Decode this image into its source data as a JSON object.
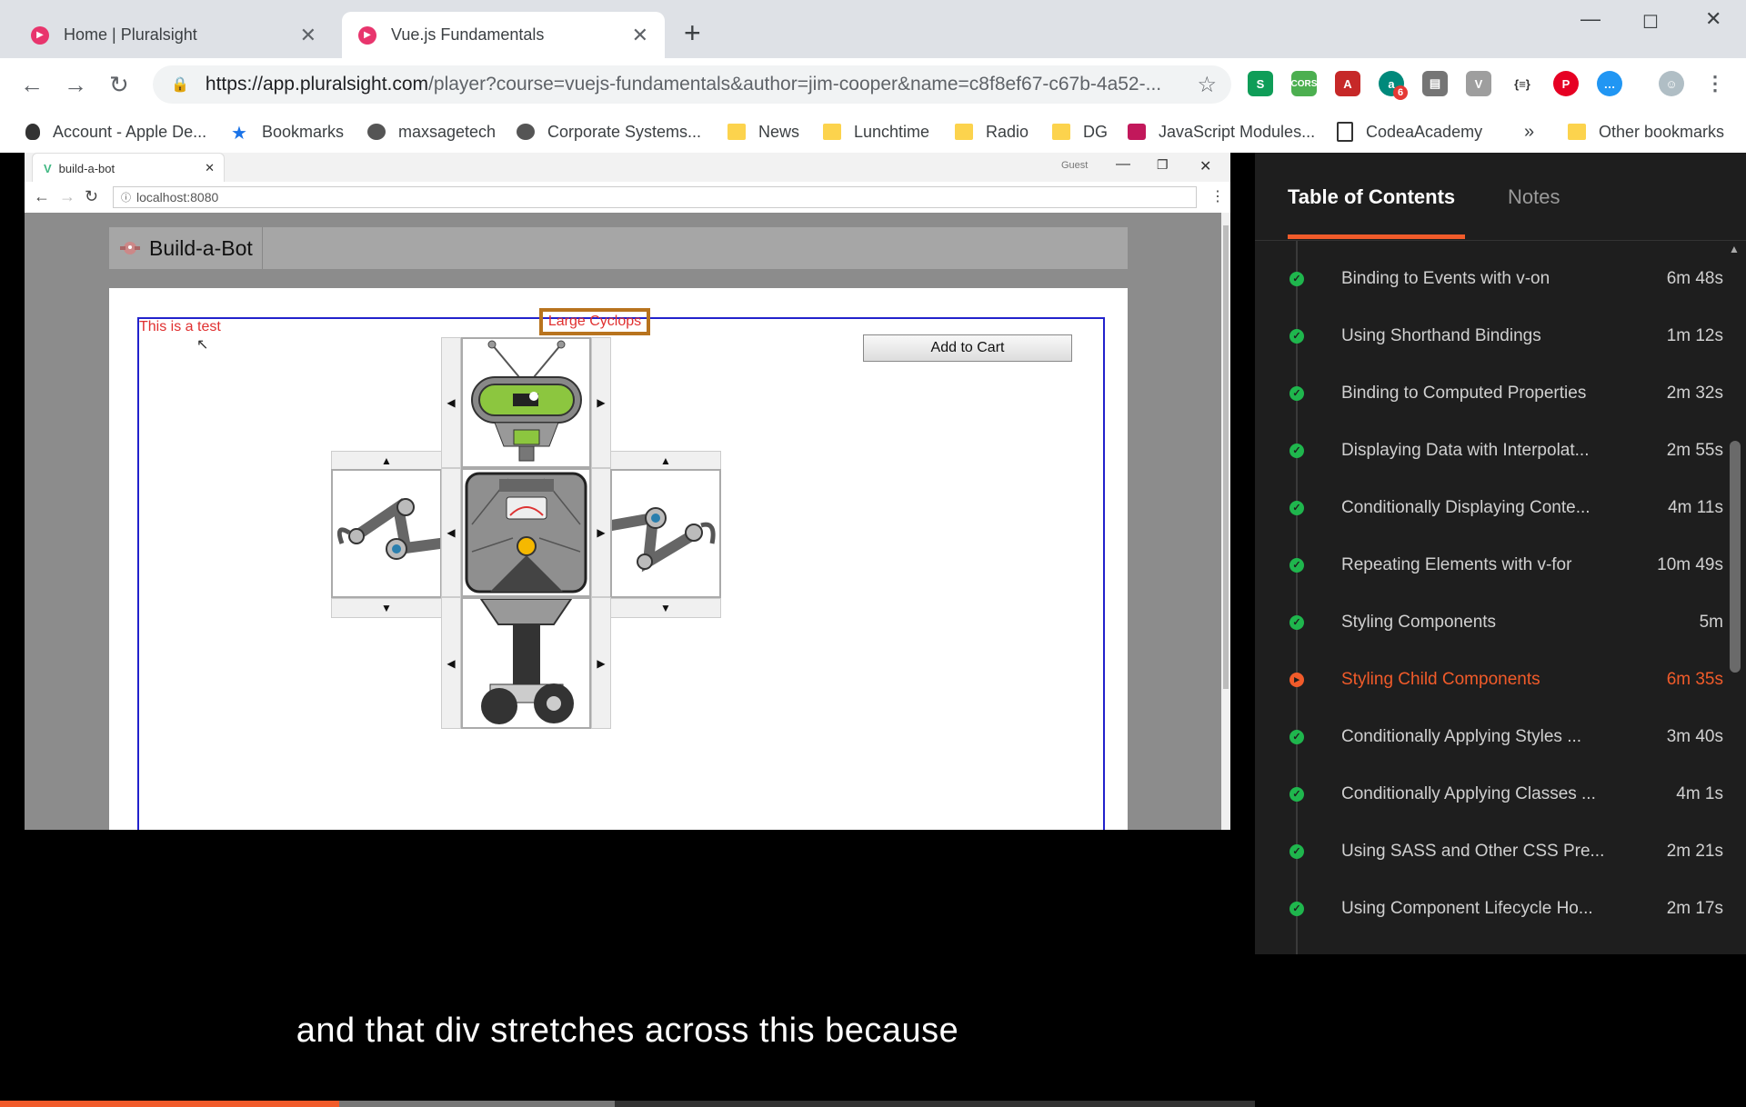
{
  "browser": {
    "tabs": [
      {
        "title": "Home | Pluralsight"
      },
      {
        "title": "Vue.js Fundamentals"
      }
    ],
    "url_host": "https://app.pluralsight.com",
    "url_path": "/player?course=vuejs-fundamentals&author=jim-cooper&name=c8f8ef67-c67b-4a52-...",
    "bookmarks": [
      "Account - Apple De...",
      "Bookmarks",
      "maxsagetech",
      "Corporate Systems...",
      "News",
      "Lunchtime",
      "Radio",
      "DG",
      "JavaScript Modules...",
      "CodeaAcademy",
      "Other bookmarks"
    ],
    "bookmarks_more": "»",
    "ext_badge": "6"
  },
  "inner_browser": {
    "tab_title": "build-a-bot",
    "profile": "Guest",
    "url": "localhost:8080"
  },
  "app": {
    "brand": "Build-a-Bot",
    "test_text": "This is a test",
    "robot_name": "Large Cyclops",
    "add_to_cart": "Add to Cart"
  },
  "video": {
    "caption": "and that div stretches across this because",
    "progress": 0.27,
    "buffered": 0.49
  },
  "panel": {
    "tabs": [
      "Table of Contents",
      "Notes"
    ],
    "clips": [
      {
        "name": "Binding to Events with v-on",
        "duration": "6m 48s",
        "status": "done"
      },
      {
        "name": "Using Shorthand Bindings",
        "duration": "1m 12s",
        "status": "done"
      },
      {
        "name": "Binding to Computed Properties",
        "duration": "2m 32s",
        "status": "done"
      },
      {
        "name": "Displaying Data with Interpolat...",
        "duration": "2m 55s",
        "status": "done"
      },
      {
        "name": "Conditionally Displaying Conte...",
        "duration": "4m 11s",
        "status": "done"
      },
      {
        "name": "Repeating Elements with v-for",
        "duration": "10m 49s",
        "status": "done"
      },
      {
        "name": "Styling Components",
        "duration": "5m",
        "status": "done"
      },
      {
        "name": "Styling Child Components",
        "duration": "6m 35s",
        "status": "current"
      },
      {
        "name": "Conditionally Applying Styles ...",
        "duration": "3m 40s",
        "status": "done"
      },
      {
        "name": "Conditionally Applying Classes ...",
        "duration": "4m 1s",
        "status": "done"
      },
      {
        "name": "Using SASS and Other CSS Pre...",
        "duration": "2m 21s",
        "status": "done"
      },
      {
        "name": "Using Component Lifecycle Ho...",
        "duration": "2m 17s",
        "status": "done"
      }
    ]
  },
  "colors": {
    "accent": "#f15b2a",
    "done": "#1fb64d",
    "ps_brand": "#e8356d"
  }
}
